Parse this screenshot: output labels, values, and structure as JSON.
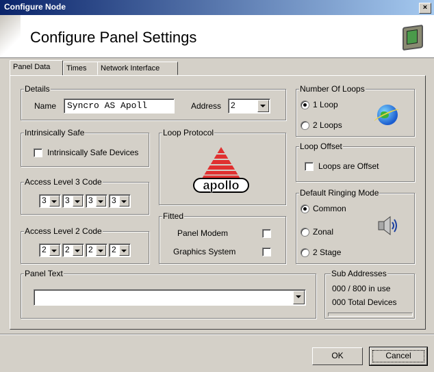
{
  "window": {
    "title": "Configure Node",
    "close_label": "×"
  },
  "header": {
    "title": "Configure Panel Settings"
  },
  "tabs": [
    {
      "label": "Panel Data"
    },
    {
      "label": "Times"
    },
    {
      "label": "Network Interface"
    }
  ],
  "details": {
    "legend": "Details",
    "name_label": "Name",
    "name_value": "Syncro AS Apoll",
    "address_label": "Address",
    "address_value": "2"
  },
  "intrinsically_safe": {
    "legend": "Intrinsically Safe",
    "checkbox_label": "Intrinsically Safe Devices"
  },
  "access_level_3": {
    "legend": "Access Level 3 Code",
    "digits": [
      "3",
      "3",
      "3",
      "3"
    ]
  },
  "access_level_2": {
    "legend": "Access Level 2 Code",
    "digits": [
      "2",
      "2",
      "2",
      "2"
    ]
  },
  "loop_protocol": {
    "legend": "Loop Protocol",
    "logo_text": "apollo"
  },
  "fitted": {
    "legend": "Fitted",
    "panel_modem_label": "Panel Modem",
    "graphics_system_label": "Graphics System"
  },
  "number_of_loops": {
    "legend": "Number Of Loops",
    "option1": "1 Loop",
    "option2": "2 Loops",
    "selected": "1 Loop"
  },
  "loop_offset": {
    "legend": "Loop Offset",
    "checkbox_label": "Loops are Offset"
  },
  "ringing_mode": {
    "legend": "Default Ringing Mode",
    "common": "Common",
    "zonal": "Zonal",
    "two_stage": "2 Stage",
    "selected": "Common"
  },
  "panel_text": {
    "legend": "Panel Text",
    "value": ""
  },
  "sub_addresses": {
    "legend": "Sub Addresses",
    "in_use": "000 / 800  in use",
    "total": "000 Total Devices"
  },
  "buttons": {
    "ok": "OK",
    "cancel": "Cancel"
  },
  "colors": {
    "title_start": "#0a246a",
    "title_end": "#a6caf0",
    "face": "#d4d0c8",
    "apollo_red": "#e03030"
  }
}
